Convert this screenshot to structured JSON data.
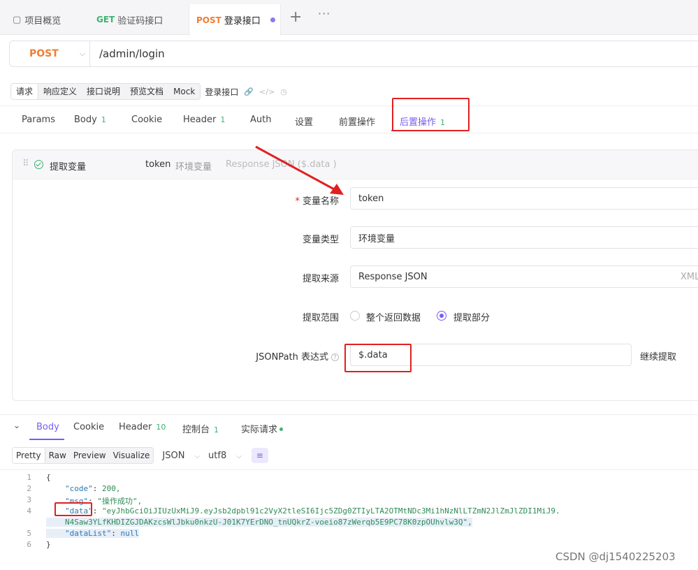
{
  "tabs": [
    {
      "label": "项目概览"
    },
    {
      "method": "GET",
      "label": "验证码接口"
    },
    {
      "method": "POST",
      "label": "登录接口"
    }
  ],
  "request": {
    "method": "POST",
    "url": "/admin/login"
  },
  "subnav": {
    "items": [
      "请求",
      "响应定义",
      "接口说明",
      "预览文档",
      "Mock"
    ],
    "title": "登录接口"
  },
  "param_tabs": [
    {
      "label": "Params"
    },
    {
      "label": "Body",
      "count": "1"
    },
    {
      "label": "Cookie"
    },
    {
      "label": "Header",
      "count": "1"
    },
    {
      "label": "Auth"
    },
    {
      "label": "设置"
    },
    {
      "label": "前置操作"
    },
    {
      "label": "后置操作",
      "count": "1"
    }
  ],
  "extract": {
    "header": {
      "name": "提取变量",
      "var": "token",
      "type": "环境变量",
      "source": "Response JSON ($.data )"
    },
    "var_name_label": "变量名称",
    "var_name_value": "token",
    "var_type_label": "变量类型",
    "var_type_value": "环境变量",
    "source_label": "提取来源",
    "source_value": "Response JSON",
    "source_right": "XML",
    "scope_label": "提取范围",
    "scope_opt1": "整个返回数据",
    "scope_opt2": "提取部分",
    "jsonpath_label": "JSONPath 表达式",
    "jsonpath_value": "$.data",
    "continue_label": "继续提取"
  },
  "response_tabs": [
    {
      "label": "Body"
    },
    {
      "label": "Cookie"
    },
    {
      "label": "Header",
      "count": "10"
    },
    {
      "label": "控制台",
      "count": "1"
    },
    {
      "label": "实际请求"
    }
  ],
  "format": {
    "modes": [
      "Pretty",
      "Raw",
      "Preview",
      "Visualize"
    ],
    "type": "JSON",
    "encoding": "utf8"
  },
  "code": {
    "line_numbers": [
      "1",
      "2",
      "3",
      "4",
      "",
      "5",
      "6"
    ],
    "open": "{",
    "code_key": "\"code\"",
    "code_val": "200,",
    "msg_key": "\"msg\"",
    "msg_val": "\"操作成功\",",
    "data_key": "\"data\"",
    "data_val_1": "\"eyJhbGciOiJIUzUxMiJ9.eyJsb2dpbl91c2VyX2tleSI6Ijc5ZDg0ZTIyLTA2OTMtNDc3Mi1hNzNlLTZmN2JlZmJlZDI1MiJ9.",
    "data_val_2": "N4Saw3YLfKHDIZGJDAKzcsWlJbku0nkzU-J01K7YErDNO_tnUQkrZ-voeio87zWerqb5E9PC78K0zpOUhvlw3Q\",",
    "datalist_key": "\"dataList\"",
    "datalist_val": "null",
    "close": "}"
  },
  "watermark": "CSDN @dj1540225203",
  "colors": {
    "accent": "#7b5cf0",
    "post": "#f07d32",
    "get": "#3cb371",
    "annotation": "#e02020"
  }
}
